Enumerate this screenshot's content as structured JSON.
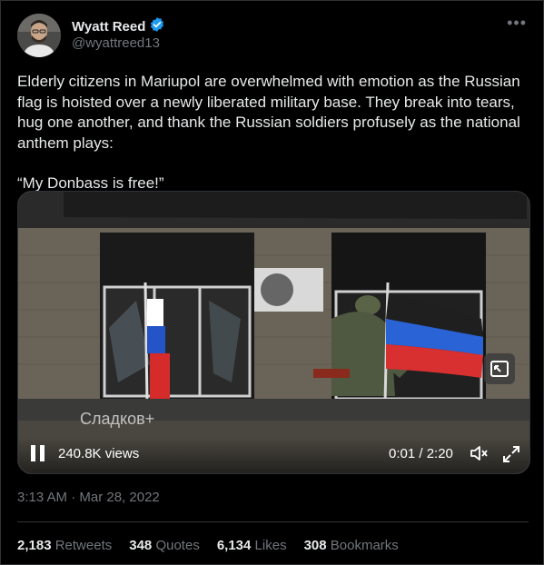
{
  "author": {
    "name": "Wyatt Reed",
    "handle": "@wyattreed13",
    "verified_color": "#1d9bf0"
  },
  "more_icon": "ellipsis-icon",
  "tweet": {
    "paragraph1": "Elderly citizens in Mariupol are overwhelmed with emotion as the Russian flag is hoisted over a newly liberated military base. They break into tears, hug one another, and thank the Russian soldiers profusely as the national anthem plays:",
    "paragraph2": "“My Donbass is free!”"
  },
  "video": {
    "watermark": "Сладков+",
    "views": "240.8K views",
    "time": "0:01 / 2:20",
    "pip_icon": "picture-in-picture-icon",
    "pause_icon": "pause-icon",
    "mute_icon": "muted-speaker-icon",
    "fullscreen_icon": "fullscreen-icon"
  },
  "timestamp": "3:13 AM · Mar 28, 2022",
  "stats": {
    "retweets_count": "2,183",
    "retweets_label": "Retweets",
    "quotes_count": "348",
    "quotes_label": "Quotes",
    "likes_count": "6,134",
    "likes_label": "Likes",
    "bookmarks_count": "308",
    "bookmarks_label": "Bookmarks"
  },
  "colors": {
    "background": "#000000",
    "text": "#e7e9ea",
    "muted": "#71767b",
    "border": "#2f3336"
  }
}
